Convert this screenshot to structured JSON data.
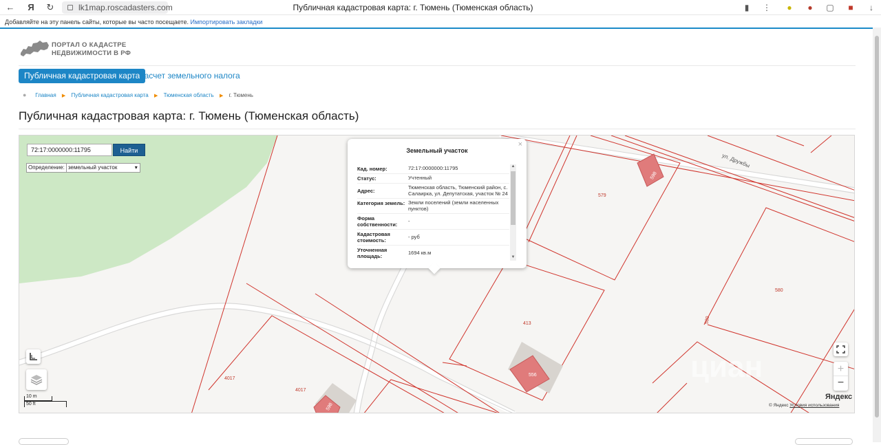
{
  "browser": {
    "url": "lk1map.roscadasters.com",
    "tab_title": "Публичная кадастровая карта: г. Тюмень (Тюменская область)",
    "bookmarks_prompt": "Добавляйте на эту панель сайты, которые вы часто посещаете.",
    "bookmarks_link": "Импортировать закладки"
  },
  "site": {
    "logo_line1": "ПОРТАЛ О КАДАСТРЕ",
    "logo_line2": "НЕДВИЖИМОСТИ В РФ",
    "tabs": [
      {
        "label": "Публичная кадастровая карта",
        "active": true
      },
      {
        "label": "Расчет земельного налога",
        "active": false
      }
    ],
    "breadcrumbs": [
      "Главная",
      "Публичная кадастровая карта",
      "Тюменская область",
      "г. Тюмень"
    ],
    "page_title": "Публичная кадастровая карта: г. Тюмень (Тюменская область)"
  },
  "map": {
    "search_value": "72:17:0000000:11795",
    "search_button": "Найти",
    "definition_label": "Определение:",
    "definition_value": "земельный участок",
    "street_label": "ул. Дружбы",
    "parcel_labels": [
      "579",
      "580",
      "413",
      "4017",
      "4017",
      "598",
      "556",
      "598",
      "580"
    ],
    "popup": {
      "title": "Земельный участок",
      "close": "×",
      "rows": [
        {
          "key": "Кад. номер:",
          "value": "72:17:0000000:11795"
        },
        {
          "key": "Статус:",
          "value": "Учтенный"
        },
        {
          "key": "Адрес:",
          "value": "Тюменская область, Тюменский район, с. Салаирка, ул. Депутатская, участок № 24"
        },
        {
          "key": "Категория земель:",
          "value": "Земли поселений (земли населенных пунктов)"
        },
        {
          "key": "Форма собственности:",
          "value": "-"
        },
        {
          "key": "Кадастровая стоимость:",
          "value": "- руб"
        },
        {
          "key": "Уточненная площадь:",
          "value": "1694 кв.м"
        }
      ]
    },
    "scale_m": "10 m",
    "scale_ft": "50 ft",
    "zoom_in": "+",
    "zoom_out": "−",
    "provider": "Яндекс",
    "copyright": "© Яндекс",
    "terms": "Условия использования",
    "watermark": "циан"
  },
  "colors": {
    "accent": "#1d86c6",
    "parcel_border": "#d0342c",
    "parcel_fill": "#e07b7b",
    "park": "#cde8c5"
  }
}
